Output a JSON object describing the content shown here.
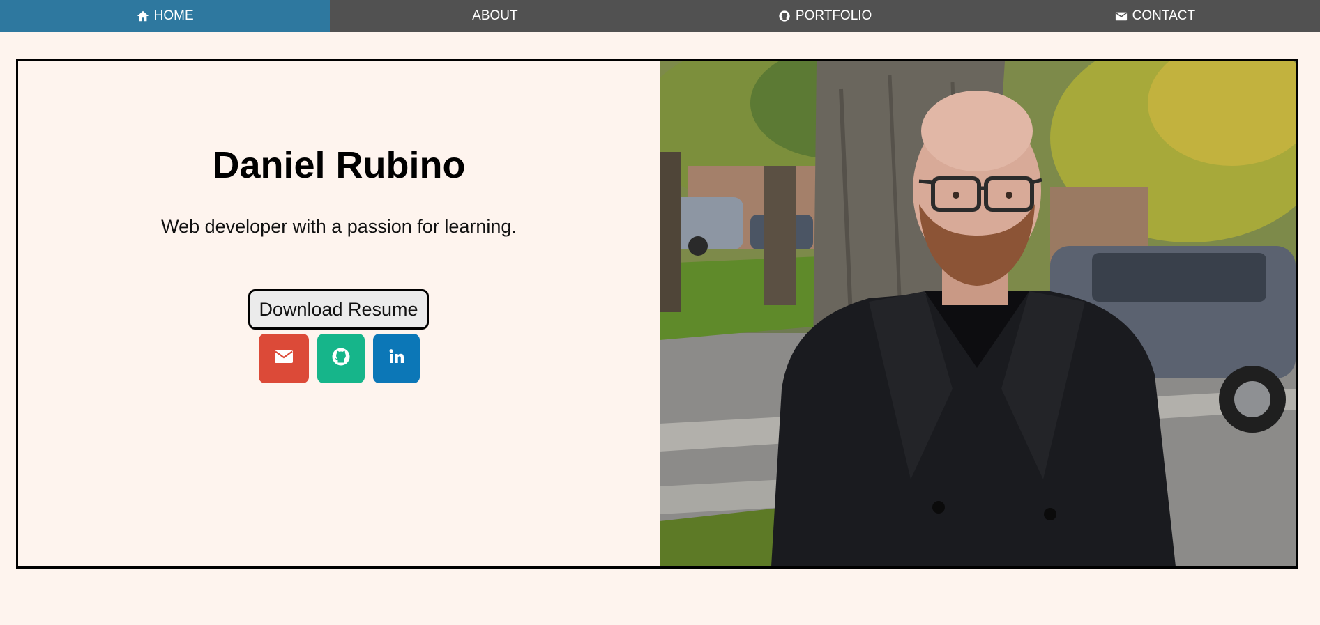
{
  "nav": {
    "items": [
      {
        "label": "HOME",
        "icon": "home-icon",
        "active": true
      },
      {
        "label": "ABOUT",
        "icon": "",
        "active": false
      },
      {
        "label": "PORTFOLIO",
        "icon": "github-icon",
        "active": false
      },
      {
        "label": "CONTACT",
        "icon": "envelope-icon",
        "active": false
      }
    ],
    "background": "#515151",
    "active_background": "#2e789f"
  },
  "hero": {
    "name": "Daniel Rubino",
    "tagline": "Web developer with a passion for learning.",
    "resume_button": "Download Resume",
    "social": [
      {
        "icon": "envelope-icon",
        "color": "#dc4a38"
      },
      {
        "icon": "github-icon",
        "color": "#16b58a"
      },
      {
        "icon": "linkedin-icon",
        "color": "#0c77b7"
      }
    ],
    "photo": "profile-photo"
  },
  "colors": {
    "page_background": "#fef4ee",
    "border": "#000000"
  }
}
